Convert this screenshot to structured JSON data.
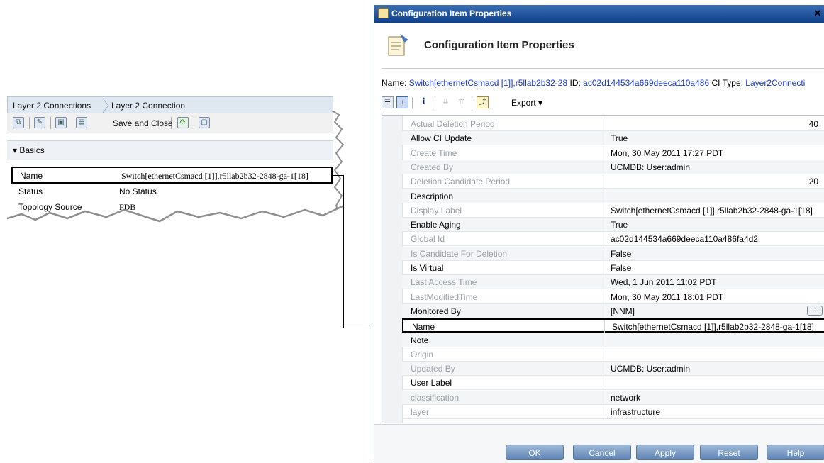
{
  "left_panel": {
    "tabs": [
      "Layer 2 Connections",
      "Layer 2 Connection"
    ],
    "toolbar": {
      "save_close_label": "Save and Close"
    },
    "section_label": "Basics",
    "rows": [
      {
        "label": "Name",
        "value": "Switch[ethernetCsmacd [1]],r5llab2b32-2848-ga-1[18]"
      },
      {
        "label": "Status",
        "value": "No Status"
      },
      {
        "label": "Topology Source",
        "value": "FDB"
      }
    ]
  },
  "dialog": {
    "title": "Configuration Item Properties",
    "header_title": "Configuration Item Properties",
    "info": {
      "name_key": "Name:",
      "name_value": "Switch[ethernetCsmacd [1]],r5llab2b32-28",
      "id_key": "ID:",
      "id_value": "ac02d144534a669deeca110a486",
      "ci_type_key": "CI Type:",
      "ci_type_value": "Layer2Connecti"
    },
    "toolbar": {
      "export_label": "Export"
    },
    "properties": [
      {
        "key": "Actual Deletion Period",
        "value": "40",
        "readonly": true,
        "numeric": true
      },
      {
        "key": "Allow CI Update",
        "value": "True",
        "readonly": false
      },
      {
        "key": "Create Time",
        "value": "Mon, 30 May 2011 17:27 PDT",
        "readonly": true
      },
      {
        "key": "Created By",
        "value": "UCMDB: User:admin",
        "readonly": true
      },
      {
        "key": "Deletion Candidate Period",
        "value": "20",
        "readonly": true,
        "numeric": true
      },
      {
        "key": "Description",
        "value": "",
        "readonly": false
      },
      {
        "key": "Display Label",
        "value": "Switch[ethernetCsmacd [1]],r5llab2b32-2848-ga-1[18]",
        "readonly": true
      },
      {
        "key": "Enable Aging",
        "value": "True",
        "readonly": false
      },
      {
        "key": "Global Id",
        "value": "ac02d144534a669deeca110a486fa4d2",
        "readonly": true
      },
      {
        "key": "Is Candidate For Deletion",
        "value": "False",
        "readonly": true
      },
      {
        "key": "Is Virtual",
        "value": "False",
        "readonly": false
      },
      {
        "key": "Last Access Time",
        "value": "Wed, 1 Jun 2011 11:02 PDT",
        "readonly": true
      },
      {
        "key": "LastModifiedTime",
        "value": "Mon, 30 May 2011 18:01 PDT",
        "readonly": true
      },
      {
        "key": "Monitored By",
        "value": "[NNM]",
        "readonly": false,
        "ellipsis": "..."
      },
      {
        "key": "Name",
        "value": "Switch[ethernetCsmacd [1]],r5llab2b32-2848-ga-1[18]",
        "readonly": false,
        "highlight": true
      },
      {
        "key": "Note",
        "value": "",
        "readonly": false
      },
      {
        "key": "Origin",
        "value": "",
        "readonly": true
      },
      {
        "key": "Updated By",
        "value": "UCMDB: User:admin",
        "readonly": true
      },
      {
        "key": "User Label",
        "value": "",
        "readonly": false
      },
      {
        "key": "classification",
        "value": "network",
        "readonly": true
      },
      {
        "key": "layer",
        "value": "infrastructure",
        "readonly": true
      }
    ],
    "buttons": [
      "OK",
      "Cancel",
      "Apply",
      "Reset",
      "Help"
    ]
  }
}
